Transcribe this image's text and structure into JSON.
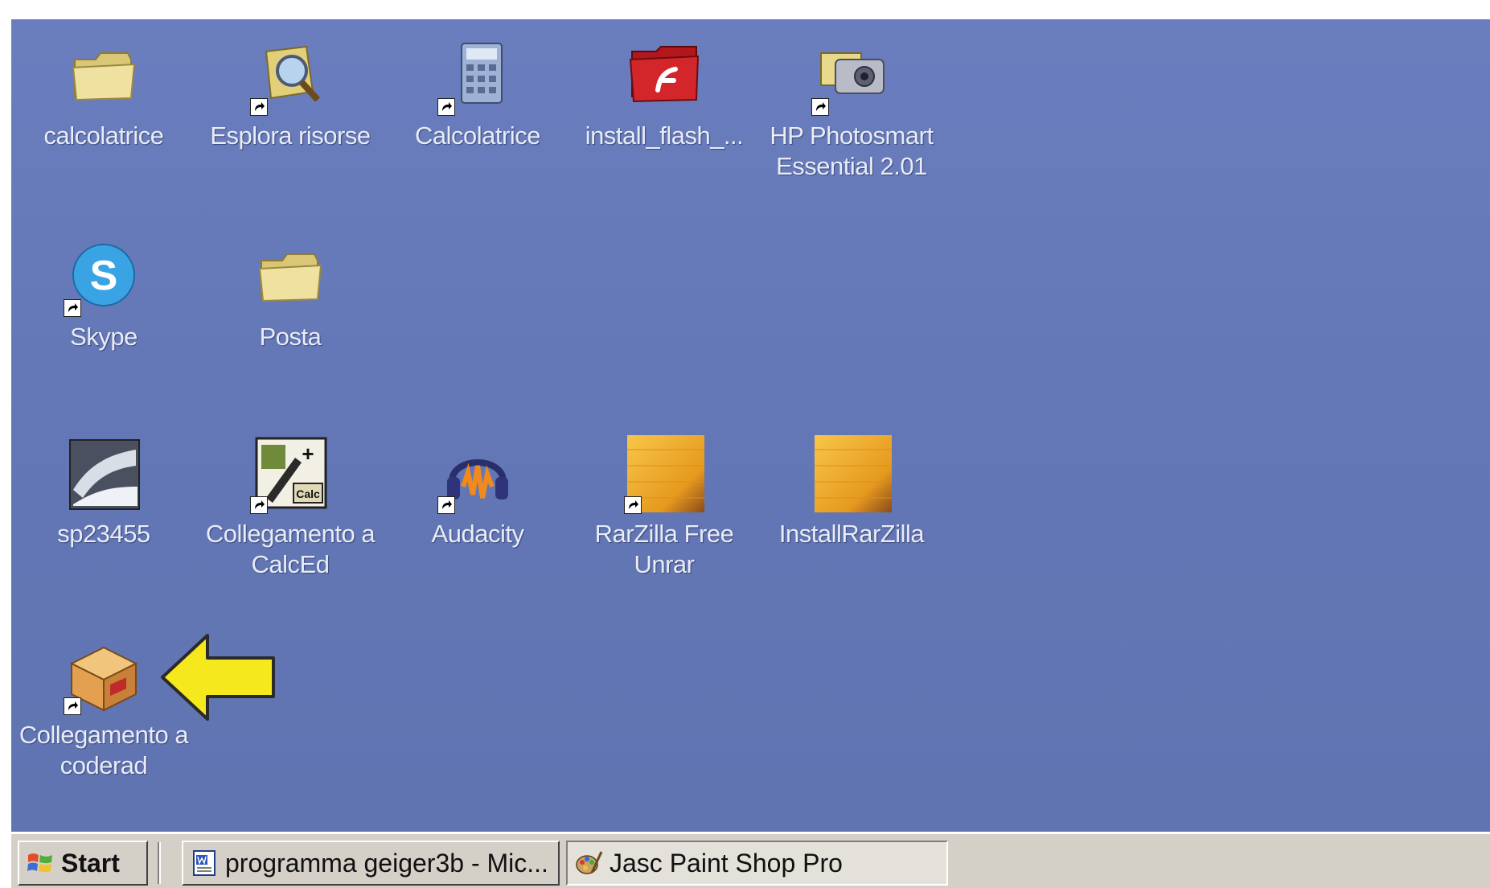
{
  "desktop": {
    "background_color": "#6579b8",
    "icons": [
      {
        "label": "calcolatrice",
        "icon": "folder-icon"
      },
      {
        "label": "Esplora risorse",
        "icon": "explorer-icon"
      },
      {
        "label": "Calcolatrice",
        "icon": "calculator-icon"
      },
      {
        "label": "install_flash_...",
        "icon": "flash-installer-icon"
      },
      {
        "label": "HP Photosmart\nEssential 2.01",
        "icon": "hp-photosmart-icon"
      },
      {
        "label": "Skype",
        "icon": "skype-icon"
      },
      {
        "label": "Posta",
        "icon": "folder-icon"
      },
      {
        "label": "sp23455",
        "icon": "sp23455-icon"
      },
      {
        "label": "Collegamento a\nCalcEd",
        "icon": "calced-icon"
      },
      {
        "label": "Audacity",
        "icon": "audacity-icon"
      },
      {
        "label": "RarZilla Free\nUnrar",
        "icon": "rarzilla-icon"
      },
      {
        "label": "InstallRarZilla",
        "icon": "rarzilla-icon"
      },
      {
        "label": "Collegamento a\ncoderad",
        "icon": "coderad-package-icon"
      }
    ],
    "arrow_color": "#f5e81c"
  },
  "taskbar": {
    "start_label": "Start",
    "tasks": [
      {
        "label": "programma geiger3b - Mic...",
        "icon": "word-document-icon"
      },
      {
        "label": "Jasc Paint Shop Pro",
        "icon": "paint-shop-pro-icon"
      }
    ]
  }
}
